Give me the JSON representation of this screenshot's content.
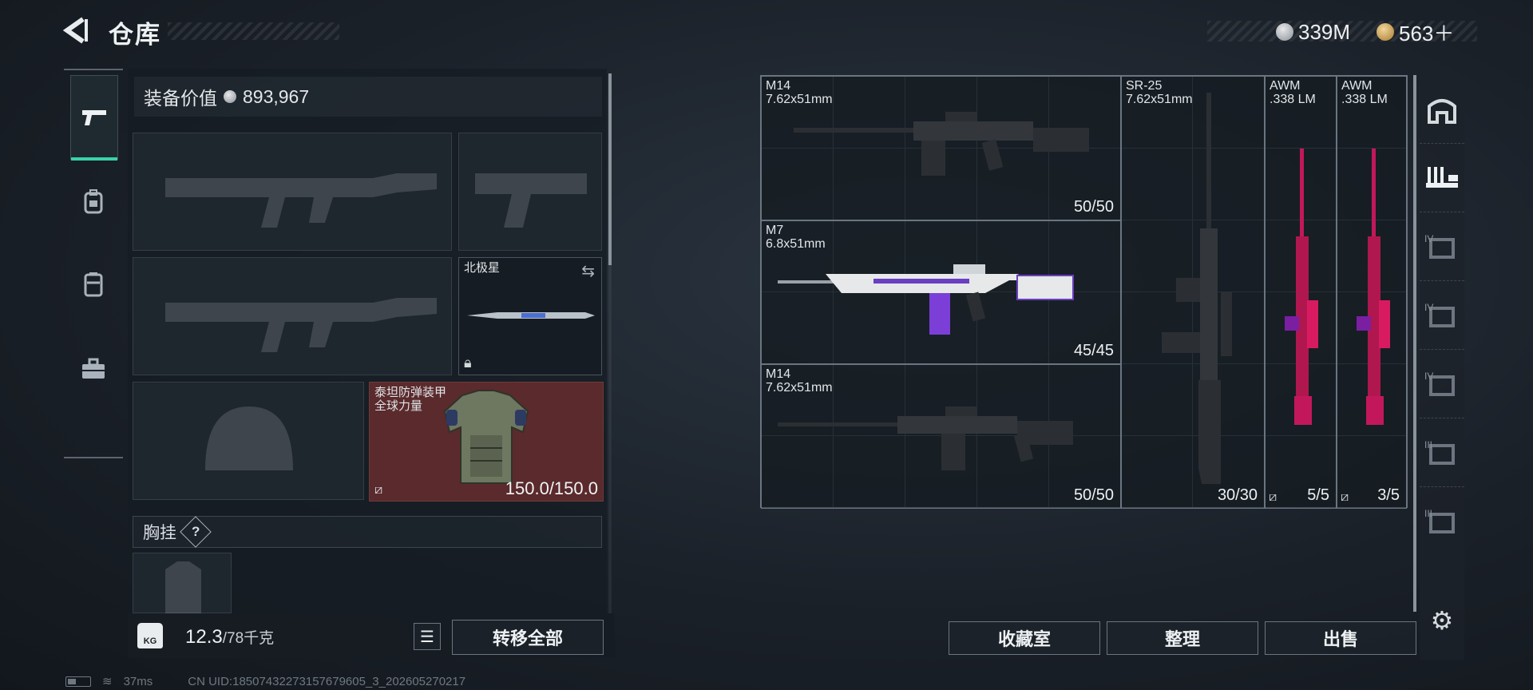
{
  "header": {
    "title": "仓库",
    "currency_silver": "339M",
    "currency_gold": "563＋"
  },
  "inventory": {
    "value_label": "装备价值",
    "value_amount": "893,967",
    "melee_name": "北极星",
    "armor_name_line1": "泰坦防弹装甲",
    "armor_name_line2": "全球力量",
    "armor_durability": "150.0/150.0",
    "chest_rig_label": "胸挂",
    "help_glyph": "?",
    "weight_current": "12.3",
    "weight_max": "/78千克",
    "weight_icon_text": "KG",
    "transfer_all_label": "转移全部"
  },
  "stash": {
    "items": [
      {
        "name": "M14",
        "caliber": "7.62x51mm",
        "ammo": "50/50"
      },
      {
        "name": "M7",
        "caliber": "6.8x51mm",
        "ammo": "45/45"
      },
      {
        "name": "M14",
        "caliber": "7.62x51mm",
        "ammo": "50/50"
      },
      {
        "name": "SR-25",
        "caliber": "7.62x51mm",
        "ammo": "30/30"
      },
      {
        "name": "AWM",
        "caliber": ".338 LM",
        "ammo": "5/5"
      },
      {
        "name": "AWM",
        "caliber": ".338 LM",
        "ammo": "3/5"
      }
    ]
  },
  "actions": {
    "collection_label": "收藏室",
    "sort_label": "整理",
    "sell_label": "出售"
  },
  "right_nav": {
    "tier_labels": [
      "IV",
      "IV",
      "IV",
      "III",
      "III"
    ]
  },
  "status": {
    "ping": "37ms",
    "uid": "CN UID:18507432273157679605_3_202605270217"
  },
  "colors": {
    "accent": "#39d3a8",
    "armor_bg": "#5a2a2c",
    "awm_skin": "#c2185b"
  }
}
